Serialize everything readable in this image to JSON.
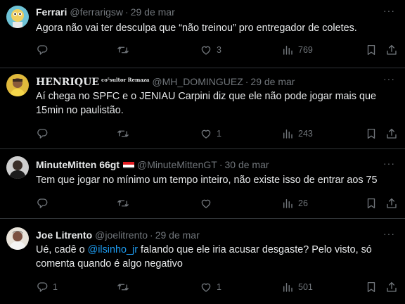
{
  "tweets": [
    {
      "name": "Ferrari",
      "handle": "@ferrarigsw",
      "sep": "·",
      "date": "29 de mar",
      "text": "Agora não vai ter desculpa que “não treinou” pro entregador de coletes.",
      "replies": "",
      "retweets": "",
      "likes": "3",
      "views": "769"
    },
    {
      "name": "HENRIQUE",
      "name_tag": "co⁵sultor Remaza",
      "handle": "@MH_DOMINGUEZ",
      "sep": "·",
      "date": "29 de mar",
      "text": "Aí chega no SPFC e o JENIAU Carpini diz que ele não pode jogar mais que 15min no paulistão.",
      "replies": "",
      "retweets": "",
      "likes": "1",
      "views": "243"
    },
    {
      "name": "MinuteMitten 66gt",
      "handle": "@MinuteMittenGT",
      "sep": "·",
      "date": "30 de mar",
      "text": "Tem que jogar no mínimo um tempo inteiro, não existe isso de entrar aos 75",
      "replies": "",
      "retweets": "",
      "likes": "",
      "views": "26"
    },
    {
      "name": "Joe Litrento",
      "handle": "@joelitrento",
      "sep": "·",
      "date": "29 de mar",
      "text_prefix": "Ué, cadê o ",
      "mention": "@ilsinho_jr",
      "text_suffix": " falando que ele iria acusar desgaste? Pelo visto, só comenta quando é algo negativo",
      "replies": "1",
      "retweets": "",
      "likes": "1",
      "views": "501"
    }
  ],
  "more_label": "···",
  "colors": {
    "background": "#000000",
    "text": "#e7e9ea",
    "muted": "#71767b",
    "divider": "#2f3336",
    "link": "#1d9bf0"
  },
  "icons": [
    "reply-icon",
    "retweet-icon",
    "like-icon",
    "views-icon",
    "bookmark-icon",
    "share-icon",
    "more-icon"
  ]
}
